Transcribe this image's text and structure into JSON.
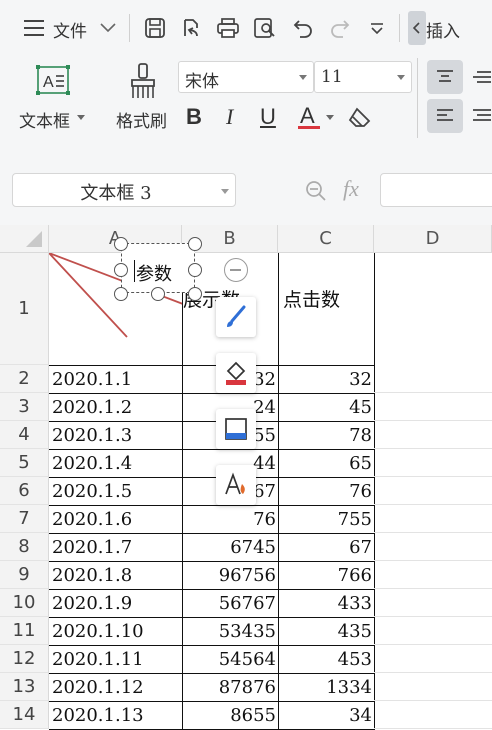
{
  "toolbar": {
    "menu_label": "文件",
    "insert_tab": "插入",
    "textbox_label": "文本框",
    "format_painter_label": "格式刷",
    "font_name": "宋体",
    "font_size": "11",
    "bold": "B",
    "italic": "I",
    "underline": "U",
    "font_color_glyph": "A"
  },
  "formula_bar": {
    "name_box": "文本框 3",
    "fx": "fx"
  },
  "columns": [
    "A",
    "B",
    "C",
    "D"
  ],
  "header_row": {
    "row_number": "1",
    "b_label": "展示数",
    "c_label": "点击数",
    "textbox_text": "参数"
  },
  "rows": [
    {
      "n": "2",
      "date": "2020.1.1",
      "shows": "232",
      "clicks": "32"
    },
    {
      "n": "3",
      "date": "2020.1.2",
      "shows": "24",
      "clicks": "45"
    },
    {
      "n": "4",
      "date": "2020.1.3",
      "shows": "655",
      "clicks": "78"
    },
    {
      "n": "5",
      "date": "2020.1.4",
      "shows": "44",
      "clicks": "65"
    },
    {
      "n": "6",
      "date": "2020.1.5",
      "shows": "65767",
      "clicks": "76"
    },
    {
      "n": "7",
      "date": "2020.1.6",
      "shows": "76",
      "clicks": "755"
    },
    {
      "n": "8",
      "date": "2020.1.7",
      "shows": "6745",
      "clicks": "67"
    },
    {
      "n": "9",
      "date": "2020.1.8",
      "shows": "96756",
      "clicks": "766"
    },
    {
      "n": "10",
      "date": "2020.1.9",
      "shows": "56767",
      "clicks": "433"
    },
    {
      "n": "11",
      "date": "2020.1.10",
      "shows": "53435",
      "clicks": "435"
    },
    {
      "n": "12",
      "date": "2020.1.11",
      "shows": "54564",
      "clicks": "453"
    },
    {
      "n": "13",
      "date": "2020.1.12",
      "shows": "87876",
      "clicks": "1334"
    },
    {
      "n": "14",
      "date": "2020.1.13",
      "shows": "8655",
      "clicks": "34"
    }
  ],
  "colors": {
    "accent_red": "#d9363e",
    "brush_blue": "#2f6fd6",
    "selection_handle": "#555555"
  }
}
